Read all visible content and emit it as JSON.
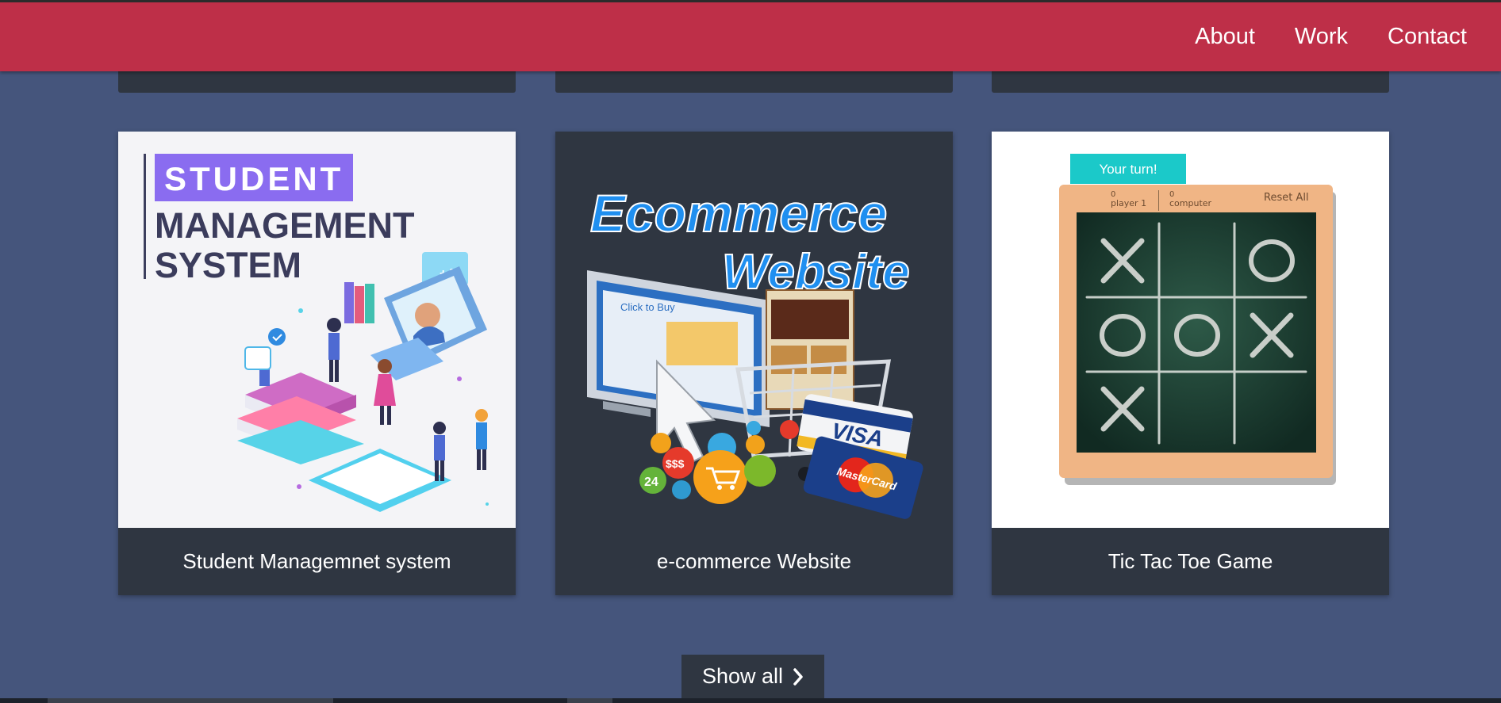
{
  "nav": {
    "items": [
      {
        "label": "About"
      },
      {
        "label": "Work"
      },
      {
        "label": "Contact"
      }
    ]
  },
  "projects": [
    {
      "title": "Student Managemnet system",
      "thumbnail": {
        "tag": "STUDENT",
        "line1": "MANAGEMENT",
        "line2": "SYSTEM",
        "icon": "students-studying-illustration"
      }
    },
    {
      "title": "e-commerce Website",
      "thumbnail": {
        "line1": "Ecommerce",
        "line2": "Website",
        "screen_logo": "Click to Buy",
        "card_visa": "VISA",
        "card_mastercard": "MasterCard",
        "price_badge": "$$$",
        "support_badge": "24",
        "icon": "shopping-cart-illustration"
      }
    },
    {
      "title": "Tic Tac Toe Game",
      "thumbnail": {
        "status": "Your turn!",
        "player_score": "0",
        "player_label": "player 1",
        "computer_score": "0",
        "computer_label": "computer",
        "reset_label": "Reset All",
        "board": [
          "X",
          "",
          "O",
          "O",
          "O",
          "X",
          "X",
          "",
          ""
        ]
      }
    }
  ],
  "show_all": {
    "label": "Show all",
    "icon": "chevron-right-icon"
  },
  "colors": {
    "page_bg": "#45557c",
    "navbar": "#be2f48",
    "card": "#2f3641",
    "accent_purple": "#8a6cf0",
    "accent_teal": "#1bc9c9"
  }
}
